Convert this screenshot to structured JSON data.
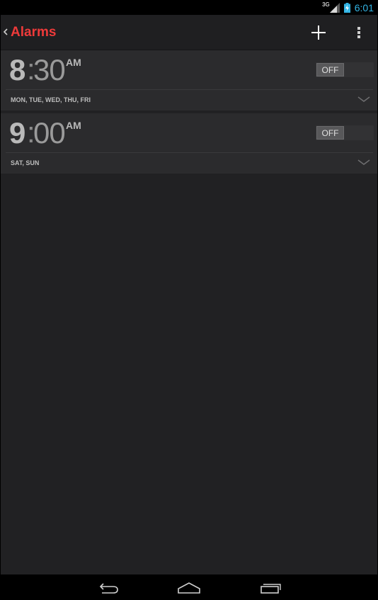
{
  "status_bar": {
    "network_type": "3G",
    "time": "6:01",
    "icons": [
      "signal-icon",
      "battery-charging-icon"
    ]
  },
  "action_bar": {
    "title": "Alarms",
    "icons": [
      "up-chevron-icon",
      "plus-icon",
      "overflow-menu-icon"
    ]
  },
  "alarms": [
    {
      "hour": "8",
      "separator": ":",
      "minutes": "30",
      "ampm": "AM",
      "toggle_label": "OFF",
      "days": "MON, TUE, WED, THU, FRI"
    },
    {
      "hour": "9",
      "separator": ":",
      "minutes": "00",
      "ampm": "AM",
      "toggle_label": "OFF",
      "days": "SAT, SUN"
    }
  ],
  "nav_bar": {
    "icons": [
      "back-icon",
      "home-icon",
      "recent-apps-icon"
    ]
  },
  "colors": {
    "accent": "#ee3a3a",
    "clock": "#33b5e5",
    "background": "#212123",
    "card": "#2b2b2d"
  }
}
